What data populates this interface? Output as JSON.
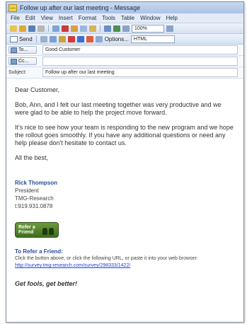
{
  "window": {
    "title": "Follow up after our last meeting - Message"
  },
  "menu": [
    "File",
    "Edit",
    "View",
    "Insert",
    "Format",
    "Tools",
    "Table",
    "Window",
    "Help"
  ],
  "toolbar": {
    "send_label": "Send",
    "zoom_value": "100%",
    "options_label": "Options...",
    "format_value": "HTML"
  },
  "header": {
    "to_label": "To...",
    "to_value": "Good Customer",
    "cc_label": "Cc...",
    "cc_value": "",
    "subject_label": "Subject:",
    "subject_value": "Follow up after our last meeting"
  },
  "message": {
    "greeting": "Dear Customer,",
    "paragraph1": "Bob, Ann, and I felt our last meeting together was very productive and we were glad to be able to help the project move forward.",
    "paragraph2": "It's nice to see how your team is responding to the new program and we hope the rollout goes smoothly.  If you have any additional questions or need any help please don't hesitate to contact us.",
    "signoff": "All the best,",
    "signature": {
      "name": "Rick Thompson",
      "title": "President",
      "company": "TMG-Research",
      "phone": "t:919.931.0878"
    },
    "refer_button_text": "Refer a Friend",
    "refer_title": "To Refer a Friend:",
    "refer_desc": "Click the button above, or click the following URL, or paste it into your web browser:",
    "refer_url": "http://survey.tmg-research.com/survey/298333/1422/",
    "closing": "Get fools, get better!"
  },
  "colors": {
    "title_bar": "#b9cfec",
    "link": "#2244cc",
    "signature_name": "#2a4b9a",
    "refer_button": "#4f7f28"
  }
}
